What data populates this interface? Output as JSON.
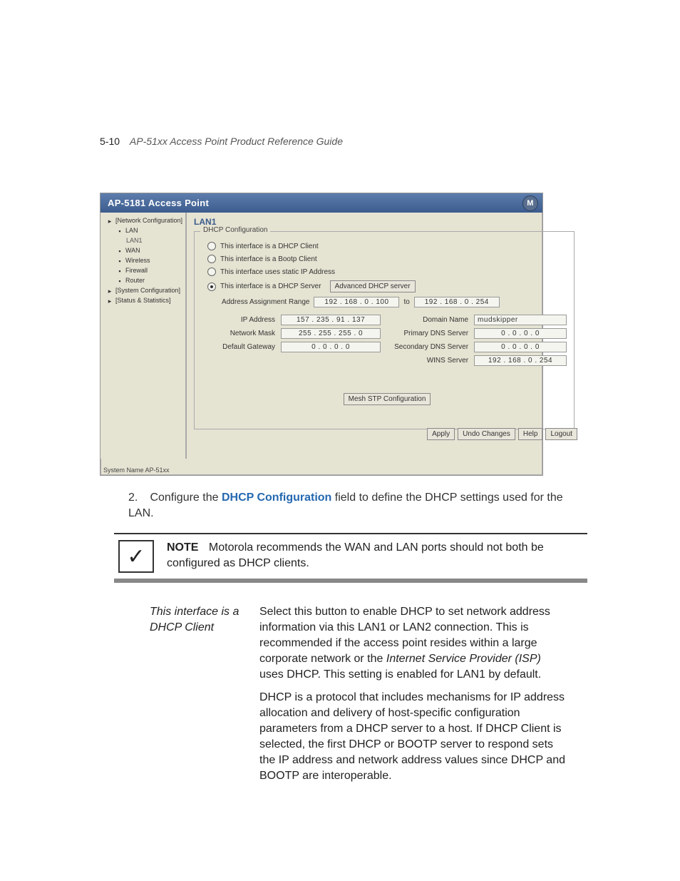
{
  "page": {
    "number": "5-10",
    "title": "AP-51xx Access Point Product Reference Guide"
  },
  "ui": {
    "title": "AP-5181 Access Point",
    "logo": "M",
    "nav": {
      "i0": "[Network Configuration]",
      "i1": "LAN",
      "i2": "LAN1",
      "i3": "WAN",
      "i4": "Wireless",
      "i5": "Firewall",
      "i6": "Router",
      "i7": "[System Configuration]",
      "i8": "[Status & Statistics]"
    },
    "panel": {
      "heading": "LAN1",
      "legend": "DHCP Configuration",
      "r0": "This interface is a DHCP Client",
      "r1": "This interface is a Bootp Client",
      "r2": "This interface uses static IP Address",
      "r3": "This interface is a DHCP Server",
      "adv_btn": "Advanced DHCP server",
      "range_label": "Address Assignment Range",
      "range_from": "192 . 168 .  0  . 100",
      "range_to_word": "to",
      "range_to": "192 . 168 .  0  . 254",
      "ip_label": "IP Address",
      "ip_val": "157 . 235 .  91  . 137",
      "mask_label": "Network Mask",
      "mask_val": "255 . 255 . 255 .  0",
      "gw_label": "Default Gateway",
      "gw_val": "0  .  0  .  0  .  0",
      "domain_label": "Domain Name",
      "domain_val": "mudskipper",
      "pdns_label": "Primary DNS Server",
      "pdns_val": "0  .  0  .  0  .  0",
      "sdns_label": "Secondary DNS Server",
      "sdns_val": "0  .  0  .  0  .  0",
      "wins_label": "WINS Server",
      "wins_val": "192 . 168 .  0  . 254",
      "mesh_btn": "Mesh STP Configuration"
    },
    "buttons": {
      "apply": "Apply",
      "undo": "Undo Changes",
      "help": "Help",
      "logout": "Logout"
    },
    "sysname": "System Name AP-51xx"
  },
  "step": {
    "num": "2.",
    "before": "Configure the ",
    "bold": "DHCP Configuration",
    "after": " field to define the DHCP settings used for the LAN."
  },
  "note": {
    "label": "NOTE",
    "text": "Motorola recommends the WAN and LAN ports should not both be configured as DHCP clients."
  },
  "def": {
    "term": "This interface is a DHCP Client",
    "p1a": "Select this button to enable DHCP to set network address information via this LAN1 or LAN2 connection. This is recommended if the access point resides within a large corporate network or the ",
    "p1i": "Internet Service Provider (ISP)",
    "p1b": " uses DHCP. This setting is enabled for LAN1 by default.",
    "p2": "DHCP is a protocol that includes mechanisms for IP address allocation and delivery of host-specific configuration parameters from a DHCP server to a host. If DHCP Client is selected, the first DHCP or BOOTP server to respond sets the IP address and network address values since DHCP and BOOTP are interoperable."
  }
}
